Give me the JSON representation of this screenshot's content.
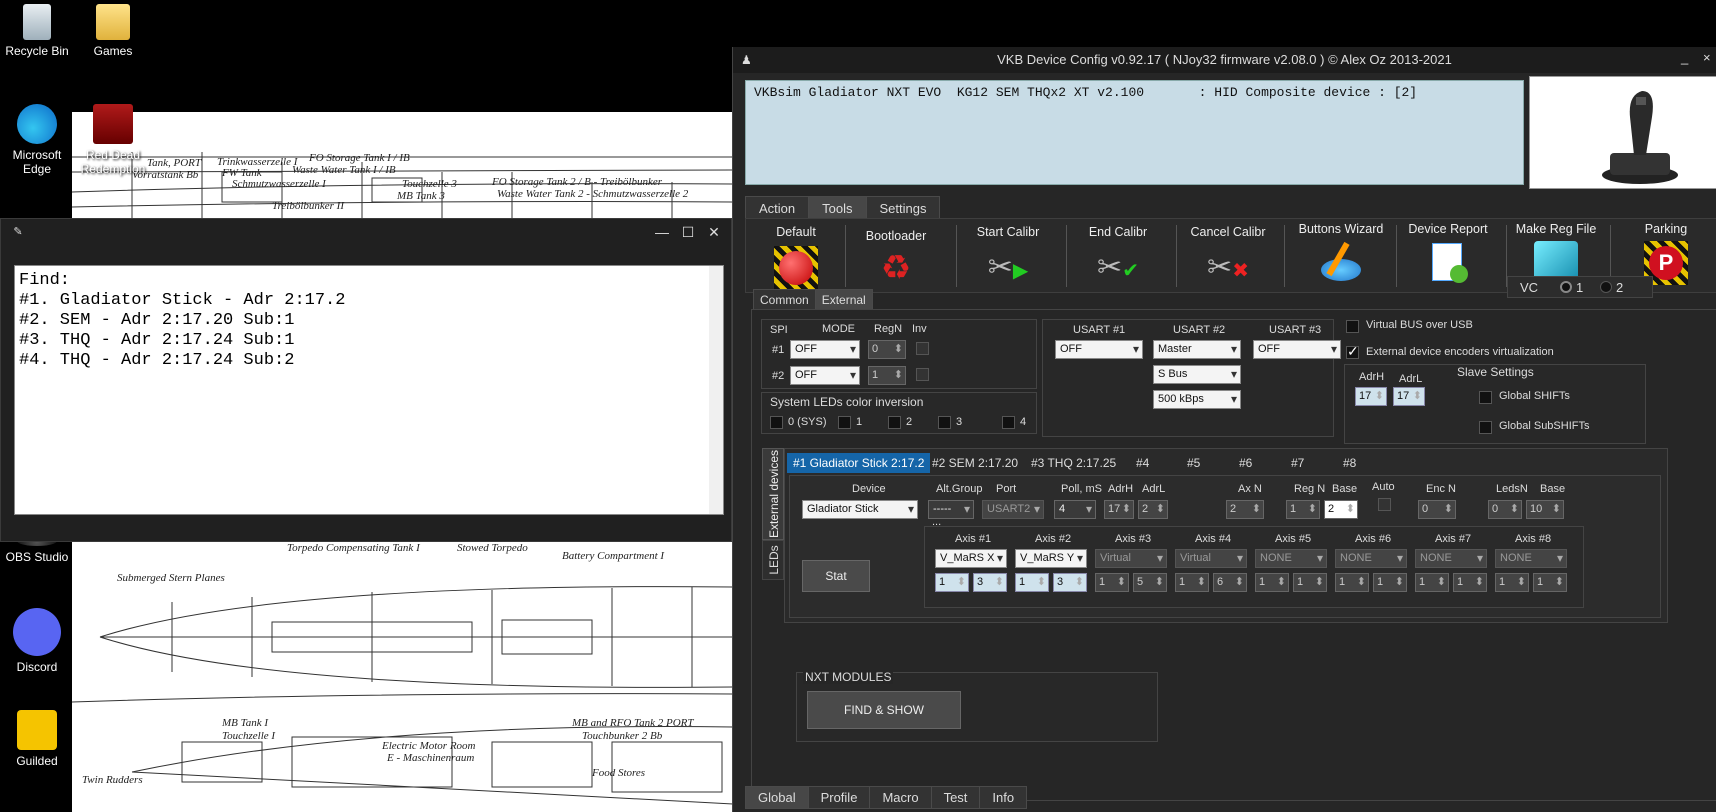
{
  "desktop": {
    "icons": [
      {
        "label": "Recycle Bin",
        "icon": "recycle-bin-icon"
      },
      {
        "label": "Games",
        "icon": "folder-icon"
      },
      {
        "label": "Microsoft Edge",
        "icon": "edge-icon"
      },
      {
        "label": "Red Dead Redemption",
        "icon": "rdr-icon"
      },
      {
        "label": "OBS Studio",
        "icon": "obs-icon"
      },
      {
        "label": "Discord",
        "icon": "discord-icon"
      },
      {
        "label": "Guilded",
        "icon": "guilded-icon"
      }
    ],
    "blueprint_top_labels": [
      "Tank, PORT",
      "Trinkwasserzelle I",
      "FO Storage Tank I / IB",
      "Vorratstank Bb",
      "FW Tank",
      "Waste Water Tank I / IB",
      "Schmutzwasserzelle I",
      "Touchzelle 3",
      "MB Tank 3",
      "FO Storage Tank 2 / B - Treibölbunker",
      "Waste Water Tank 2 - Schmutzwasserzelle 2",
      "Treibölbunker II"
    ],
    "blueprint_bottom_labels": [
      "Torpedo Compensating Tank I",
      "Stowed Torpedo",
      "Battery Compartment I",
      "Submerged Stern Planes",
      "MB Tank I",
      "Touchzelle I",
      "Electric Motor Room",
      "E - Maschinenraum",
      "MB and RFO Tank 2 PORT",
      "Touchbunker 2 Bb",
      "Food Stores",
      "Twin Rudders"
    ]
  },
  "notepad": {
    "lines": [
      "Find:",
      "#1. Gladiator Stick - Adr 2:17.2",
      "#2. SEM - Adr 2:17.20 Sub:1",
      "#3. THQ - Adr 2:17.24 Sub:1",
      "#4. THQ - Adr 2:17.24 Sub:2"
    ],
    "min": "—",
    "max": "☐",
    "close": "✕"
  },
  "vkb": {
    "title": "VKB Device Config v0.92.17 ( NJoy32 firmware v2.08.0 ) © Alex Oz 2013-2021",
    "min": "_",
    "close": "×",
    "info": "VKBsim Gladiator NXT EVO  KG12 SEM THQx2 XT v2.100       : HID Composite device : [2]",
    "main_tabs": [
      "Action",
      "Tools",
      "Settings"
    ],
    "tools": [
      {
        "label": "Default",
        "icon": "red-button-icon"
      },
      {
        "label": "Bootloader",
        "icon": "recycle-arrows-icon"
      },
      {
        "label": "Start Calibr",
        "icon": "caliper-play-icon"
      },
      {
        "label": "End Calibr",
        "icon": "caliper-check-icon"
      },
      {
        "label": "Cancel Calibr",
        "icon": "caliper-cancel-icon"
      },
      {
        "label": "Buttons Wizard",
        "icon": "wand-icon"
      },
      {
        "label": "Device Report",
        "icon": "report-icon"
      },
      {
        "label": "Make Reg File",
        "icon": "reg-file-icon"
      },
      {
        "label": "Parking",
        "icon": "parking-icon"
      }
    ],
    "sub_tabs": [
      "Common",
      "External"
    ],
    "vc": {
      "label": "VC",
      "opt1": "1",
      "opt2": "2"
    },
    "spi": {
      "spi": "SPI",
      "mode": "MODE",
      "regn": "RegN",
      "inv": "Inv",
      "r1": "#1",
      "r2": "#2",
      "mode1": "OFF",
      "mode2": "OFF",
      "regn1": "0",
      "regn2": "1"
    },
    "leds": {
      "title": "System LEDs color inversion",
      "items": [
        "0 (SYS)",
        "1",
        "2",
        "3",
        "4"
      ]
    },
    "usart": {
      "h1": "USART #1",
      "h2": "USART #2",
      "h3": "USART #3",
      "u1": "OFF",
      "u2": "Master",
      "u3": "OFF",
      "bus": "S Bus",
      "baud": "500 kBps"
    },
    "right": {
      "vbus": "Virtual BUS over USB",
      "ext": "External device encoders virtualization",
      "slave": "Slave Settings",
      "adrh": "AdrH",
      "adrl": "AdrL",
      "adrh_val": "17",
      "adrl_val": "17",
      "gshift": "Global SHIFTs",
      "gsubshift": "Global SubSHIFTs"
    },
    "side_tabs": [
      "External devices",
      "LEDs"
    ],
    "dev_tabs": [
      "#1 Gladiator Stick 2:17.2",
      "#2 SEM 2:17.20",
      "#3 THQ 2:17.25",
      "#4",
      "#5",
      "#6",
      "#7",
      "#8"
    ],
    "dev": {
      "h_device": "Device",
      "h_alt": "Alt.Group",
      "h_port": "Port",
      "h_poll": "Poll, mS",
      "h_adrh": "AdrH",
      "h_adrl": "AdrL",
      "h_axn": "Ax N",
      "h_regn": "Reg N",
      "h_base": "Base",
      "h_auto": "Auto",
      "h_encn": "Enc N",
      "h_ledsn": "LedsN",
      "h_base2": "Base",
      "device": "Gladiator Stick",
      "alt": "-----",
      "port": "USART2",
      "poll": "4",
      "adrh": "17",
      "adrl": "2",
      "axn": "2",
      "regn": "1",
      "base": "2",
      "encn": "0",
      "ledsn": "0",
      "base2": "10",
      "dots": "...",
      "stat": "Stat"
    },
    "axes": [
      {
        "h": "Axis #1",
        "sel": "V_MaRS X",
        "a": "1",
        "b": "3",
        "active": true
      },
      {
        "h": "Axis #2",
        "sel": "V_MaRS Y",
        "a": "1",
        "b": "3",
        "active": true
      },
      {
        "h": "Axis #3",
        "sel": "Virtual",
        "a": "1",
        "b": "5",
        "active": false
      },
      {
        "h": "Axis #4",
        "sel": "Virtual",
        "a": "1",
        "b": "6",
        "active": false
      },
      {
        "h": "Axis #5",
        "sel": "NONE",
        "a": "1",
        "b": "1",
        "active": false
      },
      {
        "h": "Axis #6",
        "sel": "NONE",
        "a": "1",
        "b": "1",
        "active": false
      },
      {
        "h": "Axis #7",
        "sel": "NONE",
        "a": "1",
        "b": "1",
        "active": false
      },
      {
        "h": "Axis #8",
        "sel": "NONE",
        "a": "1",
        "b": "1",
        "active": false
      }
    ],
    "nxt": {
      "title": "NXT MODULES",
      "btn": "FIND & SHOW"
    },
    "bottom_tabs": [
      "Global",
      "Profile",
      "Macro",
      "Test",
      "Info"
    ],
    "colors": {
      "accent": "#1565a8",
      "infobox": "#c8dce6",
      "default_red": "#e01010"
    }
  }
}
